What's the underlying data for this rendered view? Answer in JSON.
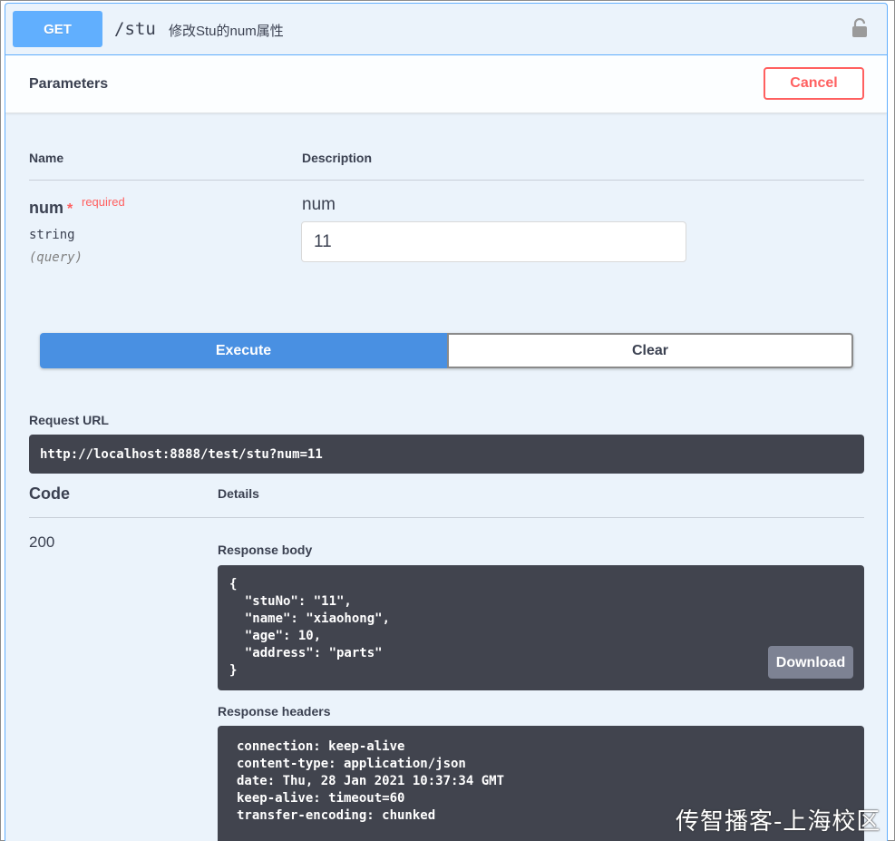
{
  "summary": {
    "method": "GET",
    "path": "/stu",
    "description": "修改Stu的num属性",
    "lock_icon": "lock-icon"
  },
  "parameters": {
    "title": "Parameters",
    "cancel_label": "Cancel",
    "columns": {
      "name": "Name",
      "description": "Description"
    },
    "param": {
      "name": "num",
      "required_star": "*",
      "required_label": "required",
      "type": "string",
      "in": "(query)",
      "description": "num",
      "value": "11"
    }
  },
  "actions": {
    "execute_label": "Execute",
    "clear_label": "Clear"
  },
  "request": {
    "label": "Request URL",
    "url": "http://localhost:8888/test/stu?num=11"
  },
  "responses": {
    "code_header": "Code",
    "details_header": "Details",
    "code": "200",
    "body_label": "Response body",
    "body": "{\n  \"stuNo\": \"11\",\n  \"name\": \"xiaohong\",\n  \"age\": 10,\n  \"address\": \"parts\"\n}",
    "download_label": "Download",
    "headers_label": "Response headers",
    "headers": "connection: keep-alive\ncontent-type: application/json\ndate: Thu, 28 Jan 2021 10:37:34 GMT\nkeep-alive: timeout=60\ntransfer-encoding: chunked"
  },
  "watermark": "传智播客-上海校区",
  "colors": {
    "get_blue": "#61affe",
    "execute_blue": "#4990e2",
    "cancel_red": "#ff6060",
    "code_bg": "#41444e"
  }
}
